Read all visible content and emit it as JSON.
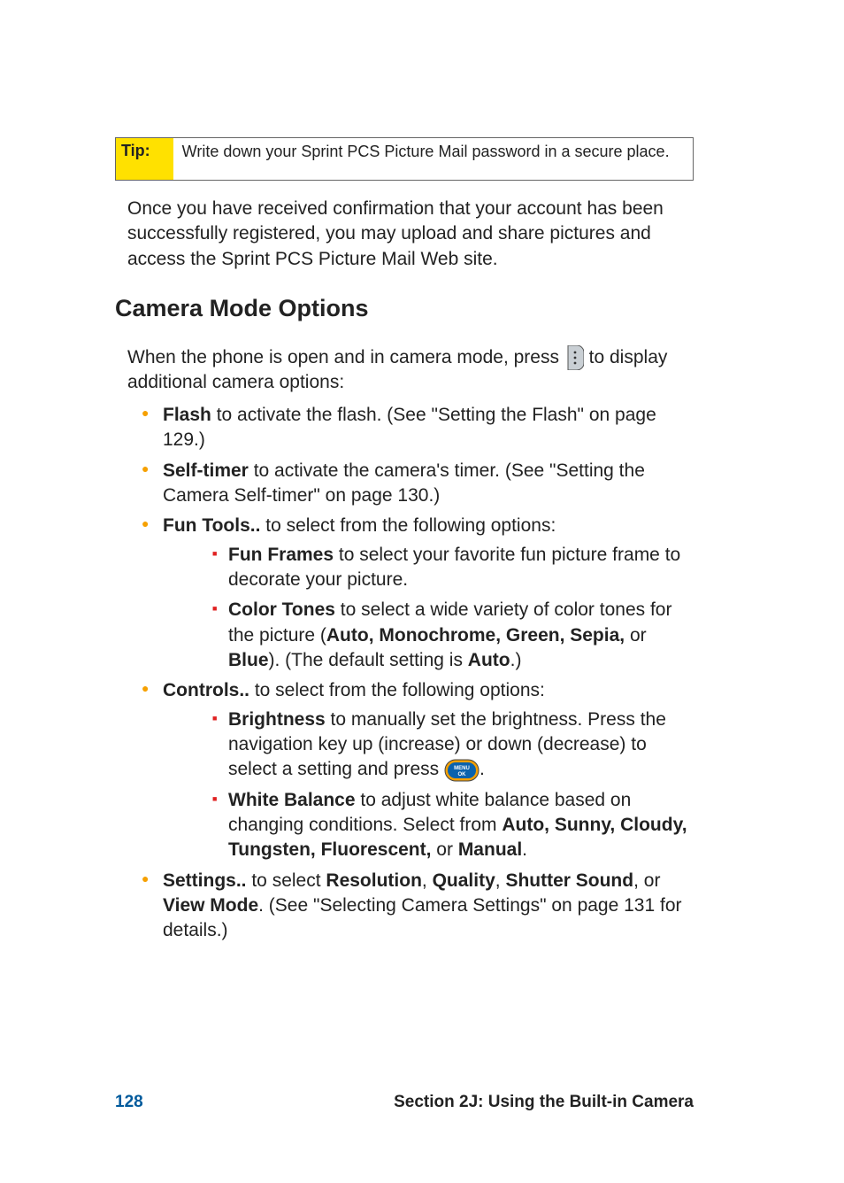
{
  "tip": {
    "label": "Tip:",
    "text": "Write down your Sprint PCS Picture Mail password in a secure place."
  },
  "intro_para": "Once you have received confirmation that your account has been successfully registered, you may upload and share pictures and access the Sprint PCS Picture Mail Web site.",
  "heading": "Camera Mode Options",
  "camera_line_a": "When the phone is open and in camera mode, press ",
  "camera_line_b": " to display additional camera options:",
  "items": {
    "flash": {
      "key": "Flash",
      "rest": " to activate the flash. (See \"Setting the Flash\" on page 129.)"
    },
    "selftimer": {
      "key": "Self-timer",
      "rest": " to activate the camera's timer. (See \"Setting the Camera Self-timer\" on page 130.)"
    },
    "funtools": {
      "key": "Fun Tools..",
      "rest": " to select from the following options:"
    },
    "funframes": {
      "key": "Fun Frames",
      "rest": " to select your favorite fun picture frame to decorate your picture."
    },
    "colortones_a": "Color Tones",
    "colortones_b": " to select a wide variety of color tones for the picture (",
    "colortones_c": "Auto, Monochrome, Green, Sepia,",
    "colortones_d": " or ",
    "colortones_e": "Blue",
    "colortones_f": "). (The default setting is ",
    "colortones_g": "Auto",
    "colortones_h": ".)",
    "controls": {
      "key": "Controls..",
      "rest": " to select from the following options:"
    },
    "brightness_a": "Brightness",
    "brightness_b": " to manually set the brightness. Press the navigation key up (increase) or down (decrease) to select a setting and press ",
    "brightness_c": ".",
    "whitebal_a": "White Balance",
    "whitebal_b": " to adjust white balance based on changing conditions. Select from ",
    "whitebal_c": "Auto, Sunny, Cloudy, Tungsten, Fluorescent,",
    "whitebal_d": " or ",
    "whitebal_e": "Manual",
    "whitebal_f": ".",
    "settings_a": "Settings..",
    "settings_b": " to select ",
    "settings_c": "Resolution",
    "settings_d": ", ",
    "settings_e": "Quality",
    "settings_f": ", ",
    "settings_g": "Shutter Sound",
    "settings_h": ", or ",
    "settings_i": "View Mode",
    "settings_j": ". (See \"Selecting Camera Settings\" on page 131 for details.)"
  },
  "footer": {
    "page": "128",
    "section": "Section 2J: Using the Built-in Camera"
  }
}
